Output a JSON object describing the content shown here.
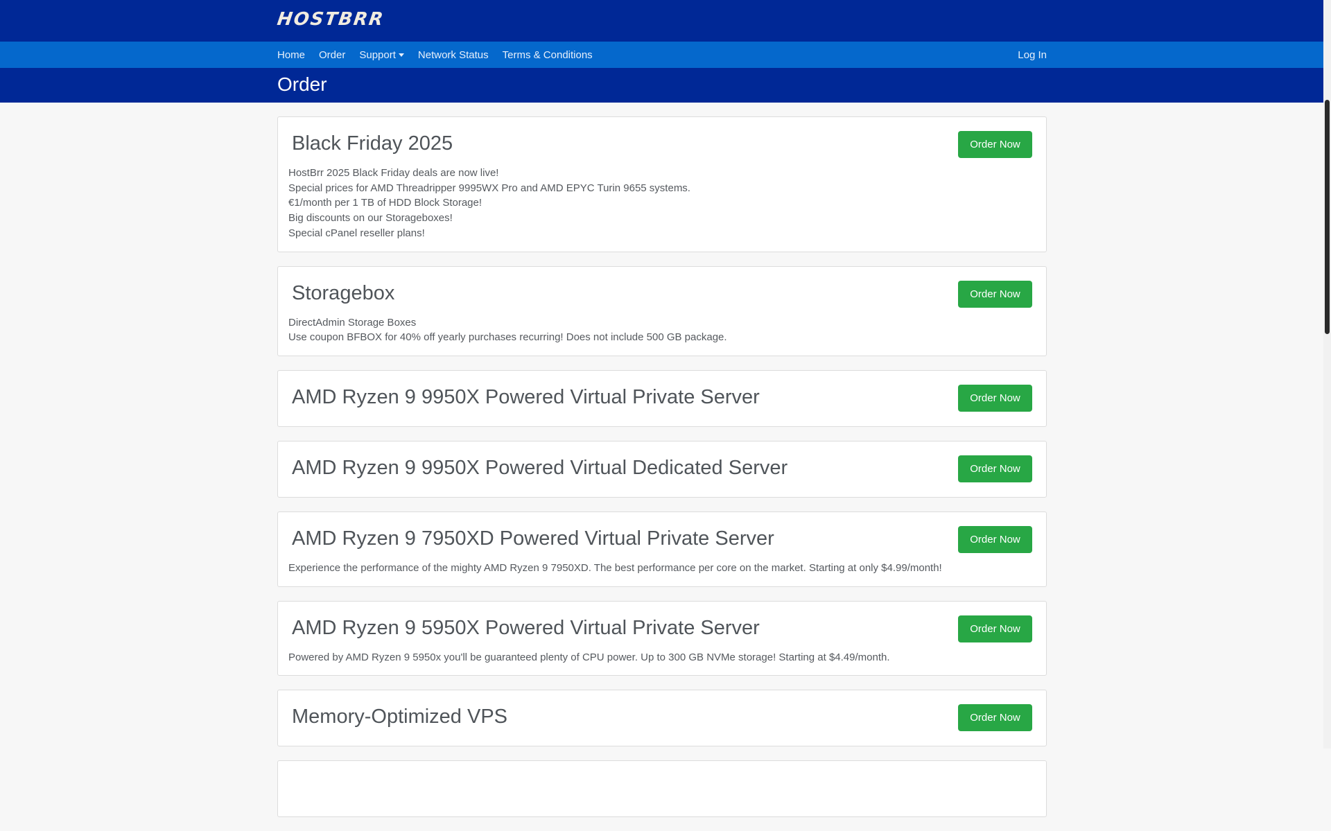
{
  "brand": {
    "logo": "HOSTBRR"
  },
  "nav": {
    "items": [
      {
        "label": "Home"
      },
      {
        "label": "Order"
      },
      {
        "label": "Support"
      },
      {
        "label": "Network Status"
      },
      {
        "label": "Terms & Conditions"
      }
    ],
    "login": "Log In"
  },
  "page": {
    "title": "Order"
  },
  "products": [
    {
      "title": "Black Friday 2025",
      "lines": [
        "HostBrr 2025 Black Friday deals are now live!",
        "Special prices for AMD Threadripper 9995WX Pro and AMD EPYC Turin 9655 systems.",
        "€1/month per 1 TB of HDD Block Storage!",
        "Big discounts on our Storageboxes!",
        "Special cPanel reseller plans!"
      ],
      "button": "Order Now"
    },
    {
      "title": "Storagebox",
      "lines": [
        "DirectAdmin Storage Boxes",
        "Use coupon BFBOX for 40% off yearly purchases recurring! Does not include 500 GB package."
      ],
      "button": "Order Now"
    },
    {
      "title": "AMD Ryzen 9 9950X Powered Virtual Private Server",
      "lines": [],
      "button": "Order Now"
    },
    {
      "title": "AMD Ryzen 9 9950X Powered Virtual Dedicated Server",
      "lines": [],
      "button": "Order Now"
    },
    {
      "title": "AMD Ryzen 9 7950XD Powered Virtual Private Server",
      "lines": [
        "Experience the performance of the mighty AMD Ryzen 9 7950XD. The best performance per core on the market. Starting at only $4.99/month!"
      ],
      "button": "Order Now"
    },
    {
      "title": "AMD Ryzen 9 5950X Powered Virtual Private Server",
      "lines": [
        "Powered by AMD Ryzen 9 5950x you'll be guaranteed plenty of CPU power. Up to 300 GB NVMe storage! Starting at $4.49/month."
      ],
      "button": "Order Now"
    },
    {
      "title": "Memory-Optimized VPS",
      "lines": [],
      "button": "Order Now"
    }
  ],
  "colors": {
    "header": "#002896",
    "nav": "#0568cc",
    "button": "#28a745"
  }
}
